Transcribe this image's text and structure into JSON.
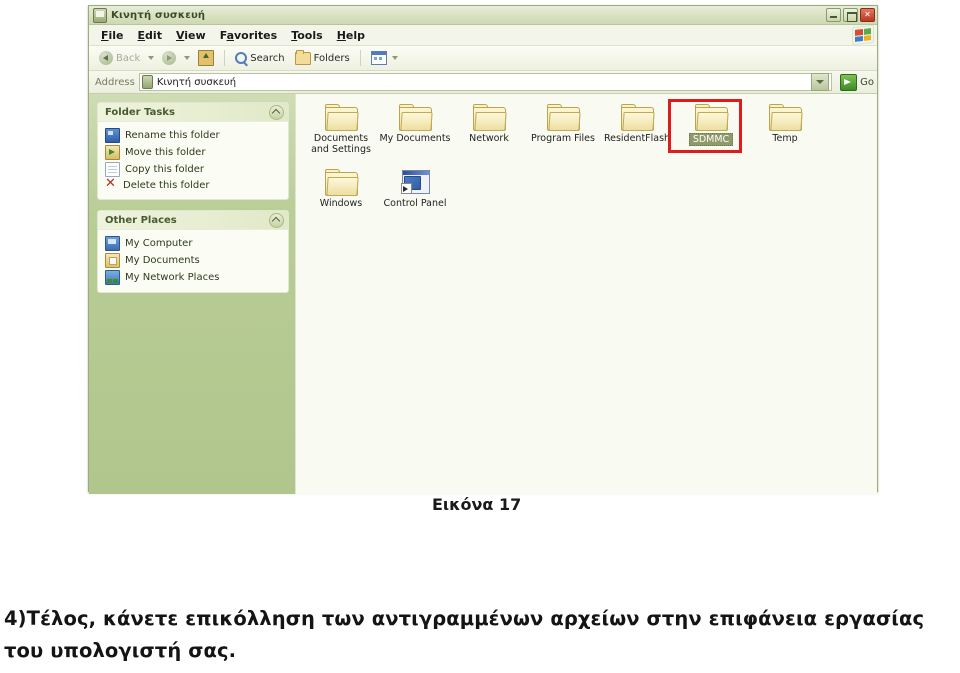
{
  "window": {
    "title": "Κινητή συσκευή",
    "title_icon": "mobile-device-icon",
    "controls": {
      "minimize": "Minimize",
      "maximize": "Maximize",
      "close": "✕"
    }
  },
  "menubar": {
    "items": [
      {
        "label": "File",
        "accel": "F",
        "rest": "ile"
      },
      {
        "label": "Edit",
        "accel": "E",
        "rest": "dit"
      },
      {
        "label": "View",
        "accel": "V",
        "rest": "iew"
      },
      {
        "label": "Favorites",
        "accel": "a",
        "rest": "vorites",
        "pre": "F"
      },
      {
        "label": "Tools",
        "accel": "T",
        "rest": "ools"
      },
      {
        "label": "Help",
        "accel": "H",
        "rest": "elp"
      }
    ],
    "branding_icon": "windows-flag-icon"
  },
  "toolbar": {
    "back_label": "Back",
    "forward_label": "",
    "up_label": "",
    "search_label": "Search",
    "folders_label": "Folders",
    "views_label": ""
  },
  "address": {
    "label": "Address",
    "value": "Κινητή συσκευή",
    "go_label": "Go"
  },
  "sidebar": {
    "panels": [
      {
        "title": "Folder Tasks",
        "items": [
          {
            "label": "Rename this folder",
            "icon": "rename-icon"
          },
          {
            "label": "Move this folder",
            "icon": "move-icon"
          },
          {
            "label": "Copy this folder",
            "icon": "copy-icon"
          },
          {
            "label": "Delete this folder",
            "icon": "delete-icon"
          }
        ]
      },
      {
        "title": "Other Places",
        "items": [
          {
            "label": "My Computer",
            "icon": "computer-icon"
          },
          {
            "label": "My Documents",
            "icon": "documents-icon"
          },
          {
            "label": "My Network Places",
            "icon": "network-places-icon"
          }
        ]
      }
    ]
  },
  "content": {
    "items": [
      {
        "label": "Documents and Settings",
        "type": "folder",
        "selected": false
      },
      {
        "label": "My Documents",
        "type": "folder",
        "selected": false
      },
      {
        "label": "Network",
        "type": "folder",
        "selected": false
      },
      {
        "label": "Program Files",
        "type": "folder",
        "selected": false
      },
      {
        "label": "ResidentFlash",
        "type": "folder",
        "selected": false
      },
      {
        "label": "SDMMC",
        "type": "folder",
        "selected": true
      },
      {
        "label": "Temp",
        "type": "folder",
        "selected": false
      },
      {
        "label": "Windows",
        "type": "folder",
        "selected": false
      },
      {
        "label": "Control Panel",
        "type": "control-panel",
        "selected": false
      }
    ],
    "annotation_color": "#e01b1b"
  },
  "document": {
    "figure_caption": "Εικόνα 17",
    "paragraph": "4)Τέλος, κάνετε επικόλληση των αντιγραμμένων αρχείων στην επιφάνεια εργασίας του υπολογιστή σας."
  }
}
